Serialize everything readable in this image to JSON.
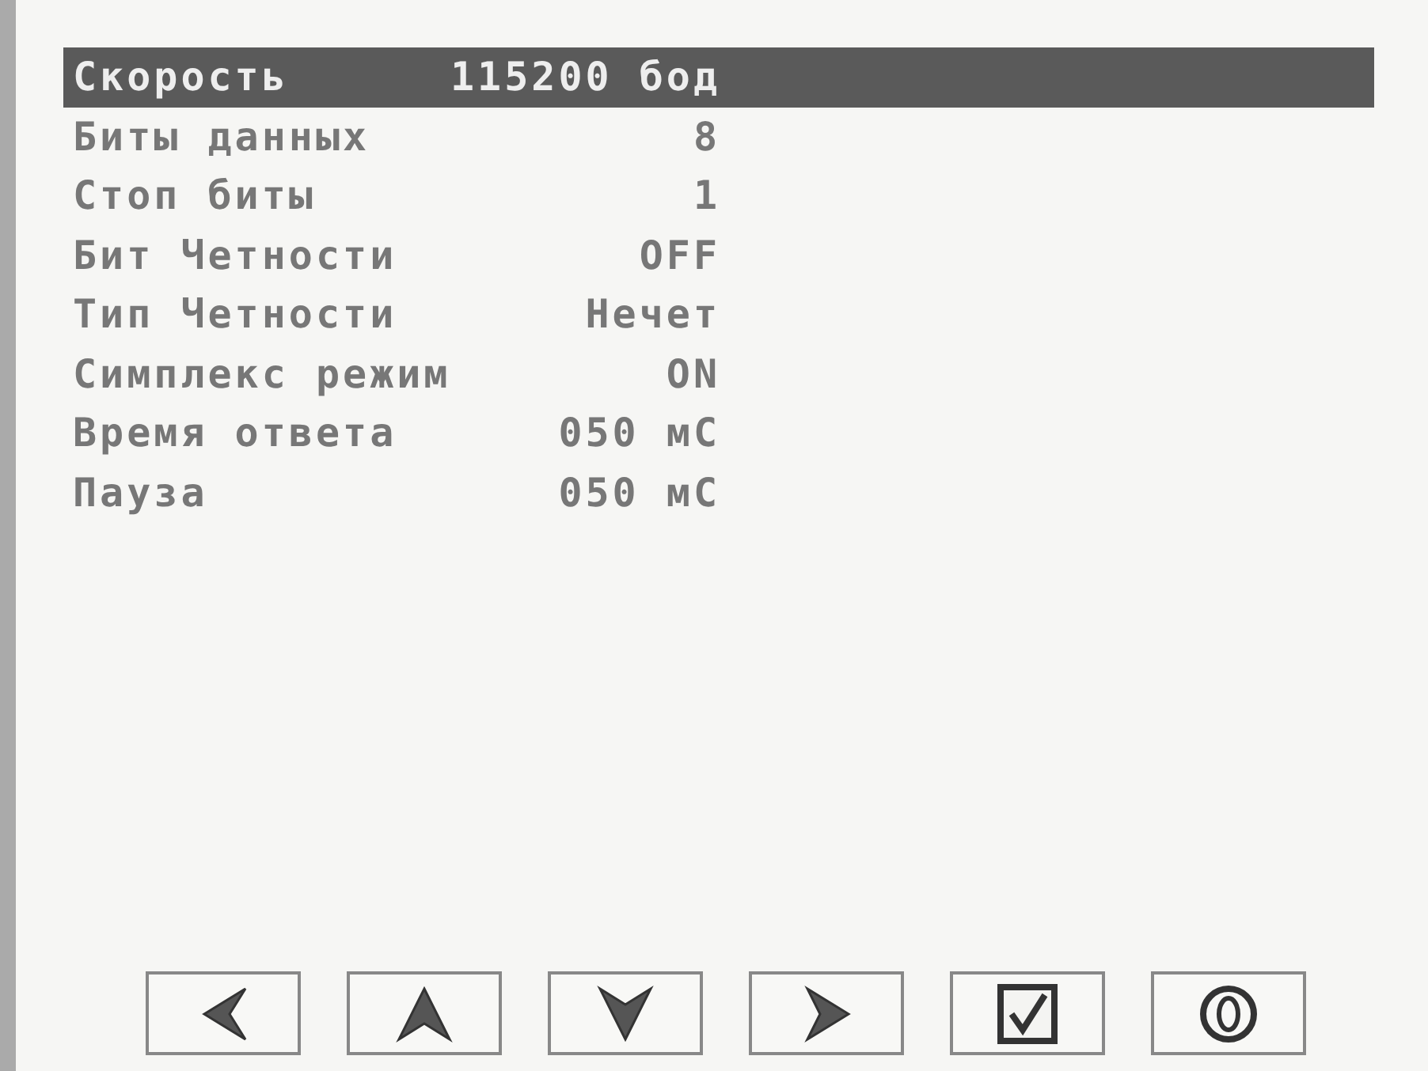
{
  "settings": [
    {
      "label": "Скорость",
      "value": "115200 бод",
      "selected": true
    },
    {
      "label": "Биты данных",
      "value": "8",
      "selected": false
    },
    {
      "label": "Стоп биты",
      "value": "1",
      "selected": false
    },
    {
      "label": "Бит Четности",
      "value": "OFF",
      "selected": false
    },
    {
      "label": "Тип Четности",
      "value": "Нечет",
      "selected": false
    },
    {
      "label": "Симплекс режим",
      "value": "ON",
      "selected": false
    },
    {
      "label": "Время ответа",
      "value": "050 мС",
      "selected": false
    },
    {
      "label": "Пауза",
      "value": "050 мС",
      "selected": false
    }
  ],
  "buttons": [
    {
      "kind": "left"
    },
    {
      "kind": "up"
    },
    {
      "kind": "down"
    },
    {
      "kind": "right"
    },
    {
      "kind": "ok"
    },
    {
      "kind": "cancel"
    }
  ]
}
